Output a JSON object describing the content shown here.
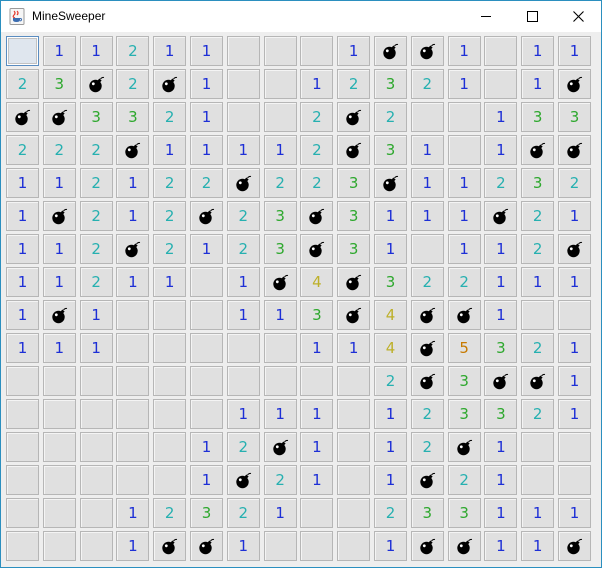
{
  "window": {
    "title": "MineSweeper",
    "icon": "java-cup-icon",
    "controls": [
      "minimize-icon",
      "maximize-icon",
      "close-icon"
    ]
  },
  "colors": {
    "1": "#1d2fd6",
    "2": "#26b0b0",
    "3": "#2ea82e",
    "4": "#bdb02a",
    "5": "#c77a00",
    "mine": "#000000"
  },
  "board": {
    "rows": 16,
    "cols": 16,
    "selected": [
      0,
      0
    ],
    "grid": [
      [
        "",
        "1",
        "1",
        "2",
        "1",
        "1",
        "",
        "",
        "",
        "1",
        "*",
        "*",
        "1",
        "",
        "1",
        "1"
      ],
      [
        "2",
        "3",
        "*",
        "2",
        "*",
        "1",
        "",
        "",
        "1",
        "2",
        "3",
        "2",
        "1",
        "",
        "1",
        "*"
      ],
      [
        "*",
        "*",
        "3",
        "3",
        "2",
        "1",
        "",
        "",
        "2",
        "*",
        "2",
        "",
        "",
        "1",
        "3",
        "3"
      ],
      [
        "2",
        "2",
        "2",
        "*",
        "1",
        "1",
        "1",
        "1",
        "2",
        "*",
        "3",
        "1",
        "",
        "1",
        "*",
        "*"
      ],
      [
        "1",
        "1",
        "2",
        "1",
        "2",
        "2",
        "*",
        "2",
        "2",
        "3",
        "*",
        "1",
        "1",
        "2",
        "3",
        "2"
      ],
      [
        "1",
        "*",
        "2",
        "1",
        "2",
        "*",
        "2",
        "3",
        "*",
        "3",
        "1",
        "1",
        "1",
        "*",
        "2",
        "1"
      ],
      [
        "1",
        "1",
        "2",
        "*",
        "2",
        "1",
        "2",
        "3",
        "*",
        "3",
        "1",
        "",
        "1",
        "1",
        "2",
        "*"
      ],
      [
        "1",
        "1",
        "2",
        "1",
        "1",
        "",
        "1",
        "*",
        "4",
        "*",
        "3",
        "2",
        "2",
        "1",
        "1",
        "1"
      ],
      [
        "1",
        "*",
        "1",
        "",
        "",
        "",
        "1",
        "1",
        "3",
        "*",
        "4",
        "*",
        "*",
        "1",
        "",
        ""
      ],
      [
        "1",
        "1",
        "1",
        "",
        "",
        "",
        "",
        "",
        "1",
        "1",
        "4",
        "*",
        "5",
        "3",
        "2",
        "1"
      ],
      [
        "",
        "",
        "",
        "",
        "",
        "",
        "",
        "",
        "",
        "",
        "2",
        "*",
        "3",
        "*",
        "*",
        "1"
      ],
      [
        "",
        "",
        "",
        "",
        "",
        "",
        "1",
        "1",
        "1",
        "",
        "1",
        "2",
        "3",
        "3",
        "2",
        "1"
      ],
      [
        "",
        "",
        "",
        "",
        "",
        "1",
        "2",
        "*",
        "1",
        "",
        "1",
        "2",
        "*",
        "1",
        "",
        ""
      ],
      [
        "",
        "",
        "",
        "",
        "",
        "1",
        "*",
        "2",
        "1",
        "",
        "1",
        "*",
        "2",
        "1",
        "",
        ""
      ],
      [
        "",
        "",
        "",
        "1",
        "2",
        "3",
        "2",
        "1",
        "",
        "",
        "2",
        "3",
        "3",
        "1",
        "1",
        "1"
      ],
      [
        "",
        "",
        "",
        "1",
        "*",
        "*",
        "1",
        "",
        "",
        "",
        "1",
        "*",
        "*",
        "1",
        "1",
        "*"
      ]
    ]
  }
}
